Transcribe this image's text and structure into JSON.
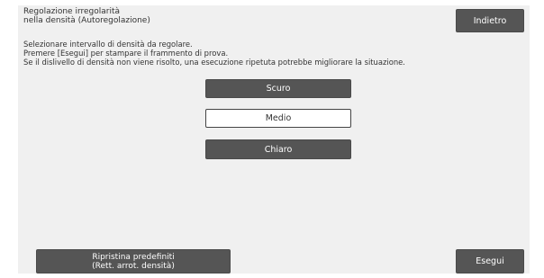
{
  "header": {
    "title_lines": [
      "Regolazione irregolarità",
      "nella densità (Autoregolazione)"
    ],
    "back_label": "Indietro"
  },
  "instructions": [
    "Selezionare intervallo di densità da regolare.",
    "Premere [Esegui] per stampare il frammento di prova.",
    "Se il dislivello di densità non viene risolto, una esecuzione ripetuta potrebbe migliorare la situazione."
  ],
  "range_options": [
    {
      "label": "Scuro",
      "selected": false
    },
    {
      "label": "Medio",
      "selected": true
    },
    {
      "label": "Chiaro",
      "selected": false
    }
  ],
  "footer": {
    "restore_lines": [
      "Ripristina predefiniti",
      "(Rett. arrot. densità)"
    ],
    "execute_label": "Esegui"
  },
  "colors": {
    "panel_bg": "#f0f0f0",
    "button_dark": "#555555",
    "button_selected_bg": "#ffffff"
  }
}
